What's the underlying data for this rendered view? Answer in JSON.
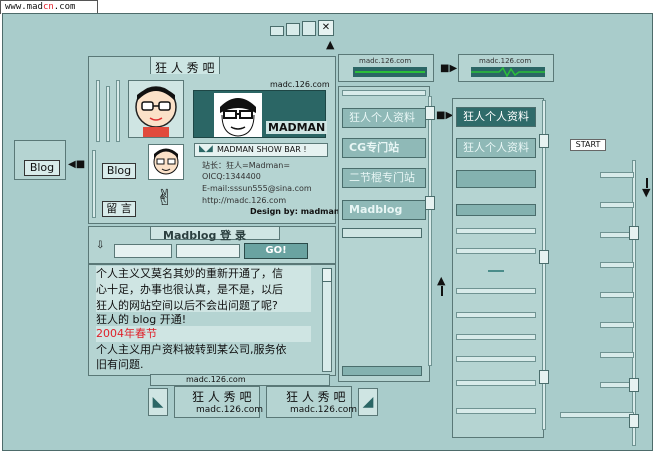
{
  "header": {
    "url_prefix": "www.mad",
    "url_highlight": "cn",
    "url_suffix": ".com"
  },
  "main_title": "狂 人 秀 吧",
  "domain_small": "madc.126.com",
  "side_buttons": {
    "blog": "Blog",
    "guestbook": "留 言"
  },
  "left_blog_button": "Blog",
  "banner": {
    "brand": "MADMAN",
    "show_bar": "MADMAN SHOW BAR !"
  },
  "profile": {
    "line1": "站长：狂人=Madman=",
    "line2": "OICQ:1344400",
    "line3": "E-mail:sssun555@sina.com",
    "line4": "http://madc.126.com",
    "line5": "Design by: madman"
  },
  "login": {
    "title": "Madblog  登  录",
    "go": "GO!"
  },
  "content": {
    "line1": "个人主义又莫名其妙的重新开通了，信",
    "line2": "心十足，办事也很认真，是不是，以后",
    "line3": "狂人的网站空间以后不会出问题了呢?",
    "line4": "狂人的  blog  开通!",
    "line5": "2004年春节",
    "line6": "个人主义用户资料被转到某公司,服务依",
    "line7": "旧有问题."
  },
  "menu": {
    "item1": "狂人个人资料",
    "item2": "CG专门站",
    "item3": "二节棍专门站",
    "item4": "Madblog"
  },
  "right_menu": {
    "item1": "狂人个人资料",
    "item2": "狂人个人资料"
  },
  "start_label": "START",
  "bottom": {
    "label1": "狂 人 秀 吧",
    "sub1": "madc.126.com",
    "label2": "狂 人 秀 吧",
    "sub2": "madc.126.com"
  },
  "colors": {
    "frame_bg": "#a9cccb",
    "dark_teal": "#2b6665",
    "accent_red": "#e0202a",
    "lcd_green": "#2bbf3a"
  }
}
